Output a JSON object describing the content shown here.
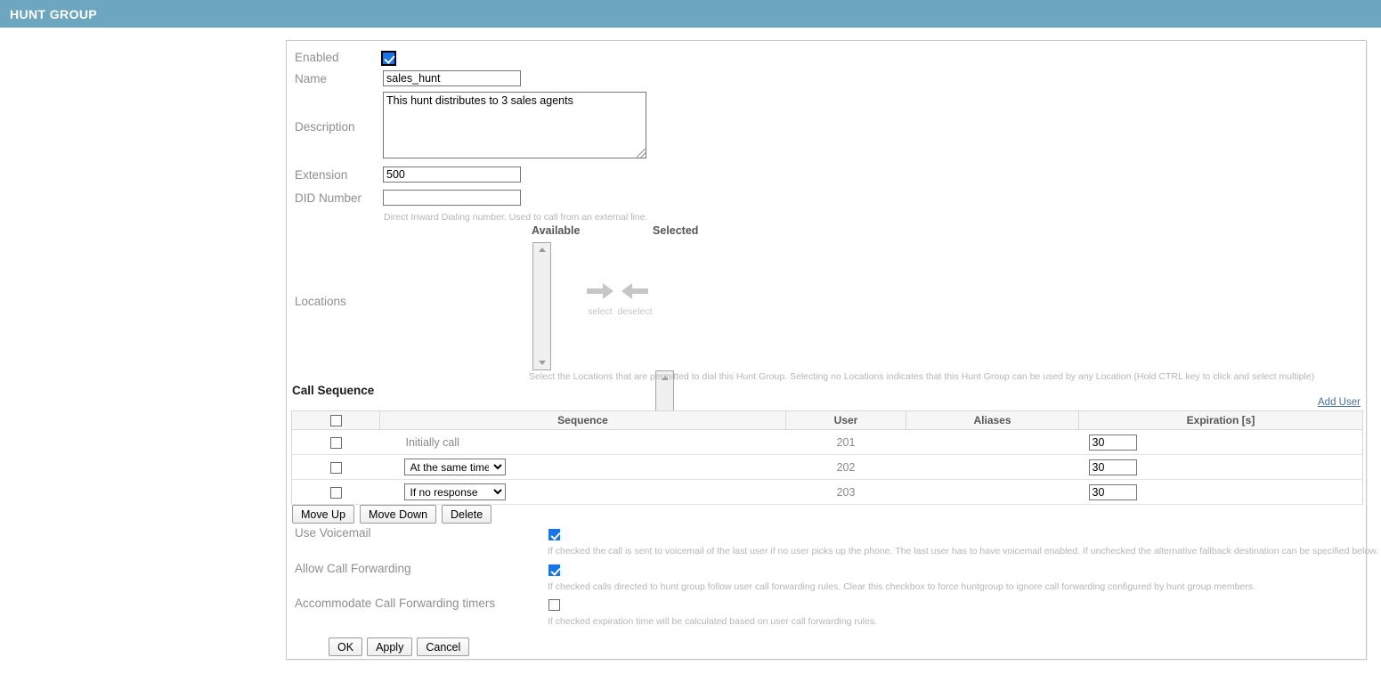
{
  "window": {
    "title": "HUNT GROUP",
    "header_color": "#6da6bf"
  },
  "form": {
    "enabled": {
      "label": "Enabled",
      "checked": true
    },
    "name": {
      "label": "Name",
      "value": "sales_hunt",
      "placeholder": ""
    },
    "description": {
      "label": "Description",
      "value": "This hunt distributes to 3 sales agents",
      "placeholder": ""
    },
    "extension": {
      "label": "Extension",
      "value": "500",
      "placeholder": ""
    },
    "did_number": {
      "label": "DID Number",
      "value": "",
      "placeholder": "",
      "help": "Direct Inward Dialing number. Used to call from an external line."
    },
    "locations": {
      "label": "Locations",
      "available_label": "Available",
      "selected_label": "Selected",
      "select_caption": "select",
      "deselect_caption": "deselect",
      "available_items": [],
      "selected_items": [],
      "help": "Select the Locations that are permitted to dial this Hunt Group. Selecting no Locations indicates that this Hunt Group can be used by any Location (Hold CTRL key to click and select multiple)"
    }
  },
  "call_sequence": {
    "title": "Call Sequence",
    "add_user_label": "Add User",
    "columns": [
      "",
      "Sequence",
      "User",
      "Aliases",
      "Expiration [s]"
    ],
    "header_checkbox_checked": false,
    "rows": [
      {
        "checked": false,
        "sequence_text": "Initially call",
        "sequence_is_select": false,
        "sequence_options": [],
        "user": "201",
        "aliases": "",
        "expiration": "30"
      },
      {
        "checked": false,
        "sequence_text": "At the same time",
        "sequence_is_select": true,
        "sequence_options": [
          "At the same time",
          "If no response"
        ],
        "user": "202",
        "aliases": "",
        "expiration": "30"
      },
      {
        "checked": false,
        "sequence_text": "If no response",
        "sequence_is_select": true,
        "sequence_options": [
          "At the same time",
          "If no response"
        ],
        "user": "203",
        "aliases": "",
        "expiration": "30"
      }
    ],
    "buttons": {
      "move_up": "Move Up",
      "move_down": "Move Down",
      "delete": "Delete"
    }
  },
  "options": {
    "use_voicemail": {
      "label": "Use Voicemail",
      "checked": true,
      "help": "If checked the call is sent to voicemail of the last user if no user picks up the phone. The last user has to have voicemail enabled. If unchecked the alternative fallback destination can be specified below."
    },
    "allow_call_forwarding": {
      "label": "Allow Call Forwarding",
      "checked": true,
      "help": "If checked calls directed to hunt group follow user call forwarding rules. Clear this checkbox to force huntgroup to ignore call forwarding configured by hunt group members."
    },
    "accommodate_call_forwarding_timers": {
      "label": "Accommodate Call Forwarding timers",
      "checked": false,
      "help": "If checked expiration time will be calculated based on user call forwarding rules."
    }
  },
  "footer": {
    "ok": "OK",
    "apply": "Apply",
    "cancel": "Cancel"
  }
}
